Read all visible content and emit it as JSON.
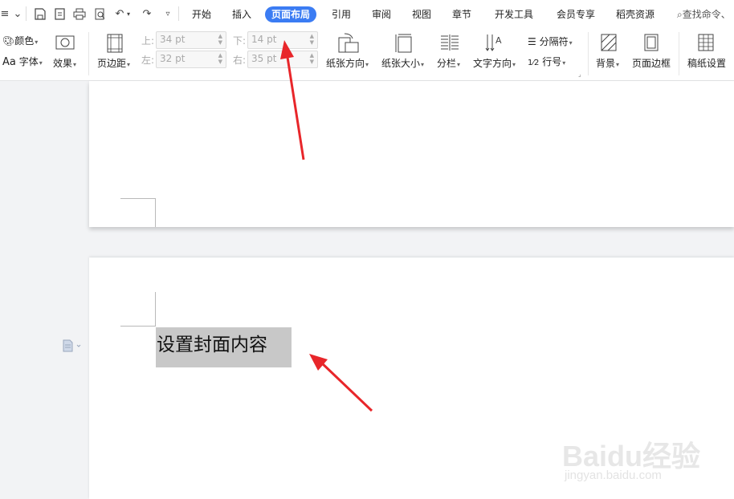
{
  "tabs": {
    "start": "开始",
    "insert": "插入",
    "layout": "页面布局",
    "references": "引用",
    "review": "审阅",
    "view": "视图",
    "section": "章节",
    "developer": "开发工具",
    "member": "会员专享",
    "resources": "稻壳资源"
  },
  "search": {
    "label": "查找命令、"
  },
  "ribbon": {
    "color": "颜色",
    "font_prefix": "Aa",
    "font": "字体",
    "effect": "效果",
    "margins": "页边距",
    "top_label": "上:",
    "top_value": "34 pt",
    "bottom_label": "下:",
    "bottom_value": "14 pt",
    "left_label": "左:",
    "left_value": "32 pt",
    "right_label": "右:",
    "right_value": "35 pt",
    "orientation": "纸张方向",
    "size": "纸张大小",
    "columns": "分栏",
    "text_direction": "文字方向",
    "separator": "分隔符",
    "line_number": "行号",
    "background": "背景",
    "page_border": "页面边框",
    "manuscript": "稿纸设置"
  },
  "document": {
    "selected_text": "设置封面内容"
  },
  "watermark": {
    "brand": "Baidu经验",
    "url": "jingyan.baidu.com"
  },
  "colors": {
    "accent": "#3b7cf3",
    "annotation": "#e8262a",
    "selection": "#c8c8c8"
  }
}
